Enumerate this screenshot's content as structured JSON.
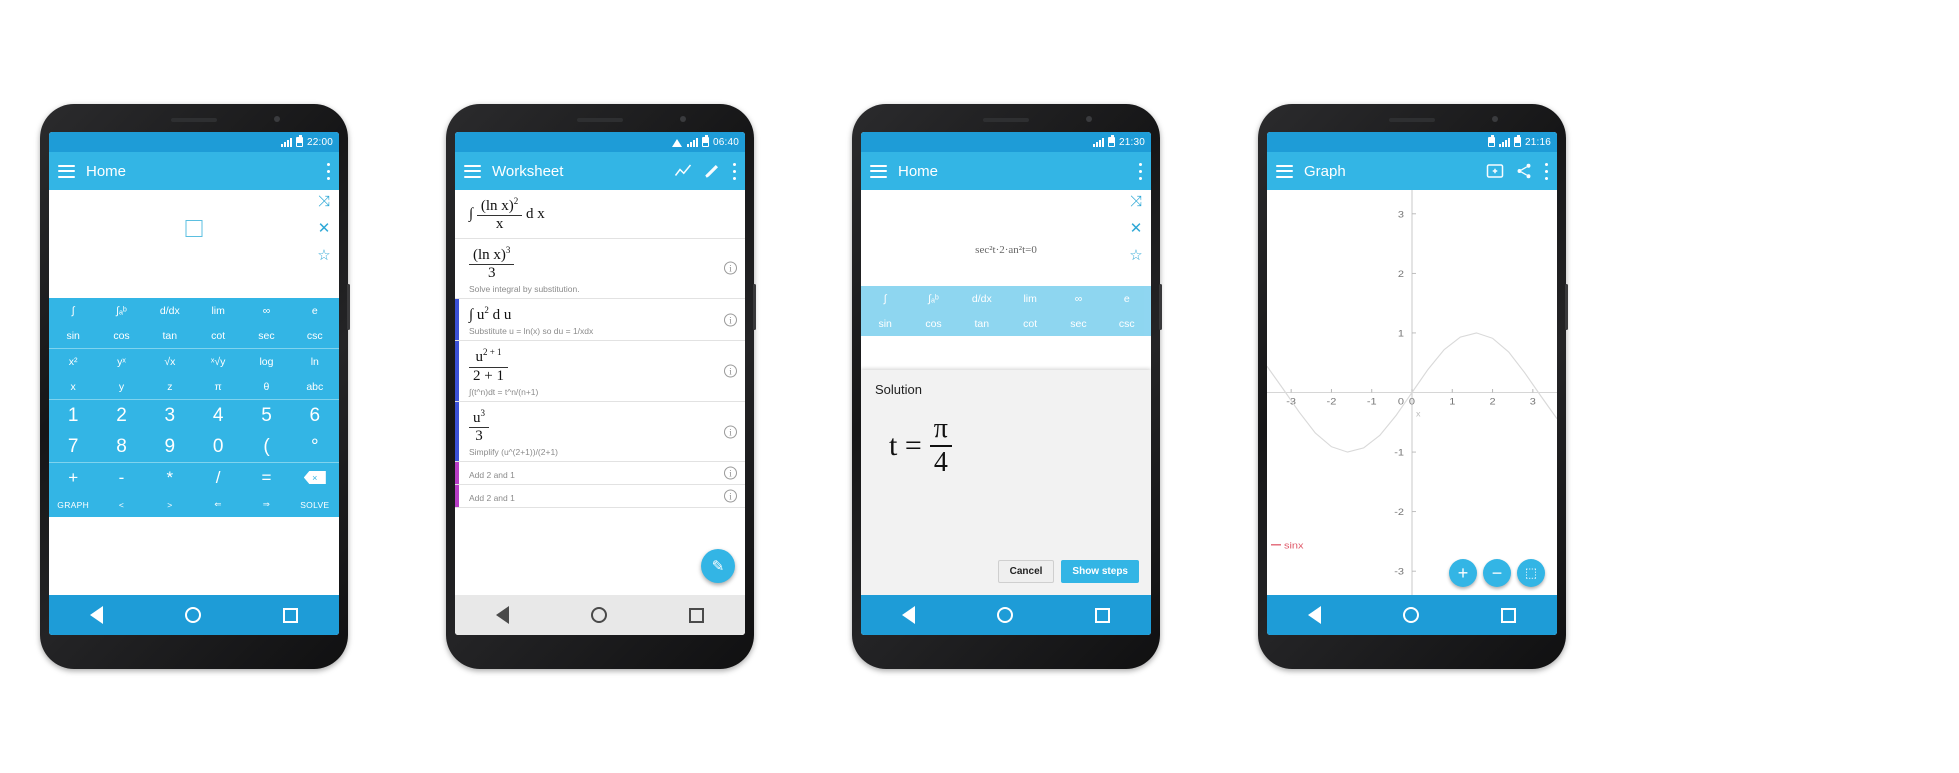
{
  "phones": [
    {
      "id": "calculator",
      "statusbar": {
        "time": "22:00",
        "icons": [
          "signal-icon",
          "battery-icon"
        ]
      },
      "appbar": {
        "title": "Home",
        "menu_icon": "hamburger-icon",
        "overflow_icon": "kebab-icon"
      },
      "input": {
        "placeholder_box": "□",
        "actions": [
          {
            "name": "shuffle-icon",
            "glyph": "⤨"
          },
          {
            "name": "close-icon",
            "glyph": "✕"
          },
          {
            "name": "star-icon",
            "glyph": "☆"
          }
        ]
      },
      "keypad_rows": [
        {
          "class": "fn",
          "keys": [
            "∫",
            "∫ₐᵇ",
            "d/dx",
            "lim",
            "∞",
            "e"
          ]
        },
        {
          "class": "fn",
          "keys": [
            "sin",
            "cos",
            "tan",
            "cot",
            "sec",
            "csc"
          ]
        },
        {
          "class": "fn sep",
          "keys": [
            "x²",
            "yˣ",
            "√x",
            "ˣ√y",
            "log",
            "ln"
          ]
        },
        {
          "class": "fn",
          "keys": [
            "x",
            "y",
            "z",
            "π",
            "θ",
            "abc"
          ]
        },
        {
          "class": "num sep",
          "keys": [
            "1",
            "2",
            "3",
            "4",
            "5",
            "6"
          ]
        },
        {
          "class": "num",
          "keys": [
            "7",
            "8",
            "9",
            "0",
            "(",
            "°"
          ]
        },
        {
          "class": "op sep",
          "keys": [
            "+",
            "-",
            "*",
            "/",
            "=",
            "⌫"
          ]
        },
        {
          "class": "small",
          "keys": [
            "GRAPH",
            "<",
            ">",
            "⇐",
            "⇒",
            "SOLVE"
          ]
        }
      ]
    },
    {
      "id": "worksheet",
      "statusbar": {
        "time": "06:40",
        "icons": [
          "wifi-icon",
          "signal-icon",
          "battery-icon"
        ]
      },
      "appbar": {
        "title": "Worksheet",
        "menu_icon": "hamburger-icon",
        "graph_icon": "chart-icon",
        "edit_icon": "pencil-icon",
        "overflow_icon": "kebab-icon"
      },
      "steps": [
        {
          "expr_html": "∫ <span class=\"frac\"><span class=\"num\">(ln x)<sup>2</sup></span><span class=\"den\">x</span></span> d x",
          "desc": "",
          "info": false,
          "mark": ""
        },
        {
          "expr_html": "<span class=\"frac\"><span class=\"num\">(ln x)<sup>3</sup></span><span class=\"den\">3</span></span>",
          "desc": "Solve integral by substitution.",
          "info": true,
          "mark": ""
        },
        {
          "expr_html": "∫ u<sup>2</sup> d u",
          "desc": "Substitute u = ln(x) so du = 1/xdx",
          "info": true,
          "mark": "marked"
        },
        {
          "expr_html": "<span class=\"frac\"><span class=\"num\">u<sup>2 + 1</sup></span><span class=\"den\">2 + 1</span></span>",
          "desc": "∫(t^n)dt = t^n/(n+1)",
          "info": true,
          "mark": "marked"
        },
        {
          "expr_html": "<span class=\"frac\"><span class=\"num\">u<sup>3</sup></span><span class=\"den\">3</span></span>",
          "desc": "Simplify (u^(2+1))/(2+1)",
          "info": true,
          "mark": "marked"
        },
        {
          "expr_html": "",
          "desc": "Add 2 and 1",
          "info": true,
          "mark": "marked2"
        },
        {
          "expr_html": "",
          "desc": "Add 2 and 1",
          "info": true,
          "mark": "marked2"
        }
      ],
      "fab": {
        "name": "edit-fab",
        "glyph": "✎"
      }
    },
    {
      "id": "solution",
      "statusbar": {
        "time": "21:30",
        "icons": [
          "signal-icon",
          "battery-icon"
        ]
      },
      "appbar": {
        "title": "Home",
        "menu_icon": "hamburger-icon",
        "overflow_icon": "kebab-icon"
      },
      "expression": "sec²t·2·an²t=0",
      "dialog": {
        "title": "Solution",
        "lhs": "t =",
        "numerator": "π",
        "denominator": "4",
        "cancel_label": "Cancel",
        "steps_label": "Show steps"
      },
      "keypad_rows": [
        {
          "class": "fn",
          "keys": [
            "∫",
            "∫ₐᵇ",
            "d/dx",
            "lim",
            "∞",
            "e"
          ]
        },
        {
          "class": "fn",
          "keys": [
            "sin",
            "cos",
            "tan",
            "cot",
            "sec",
            "csc"
          ]
        }
      ]
    },
    {
      "id": "graph",
      "statusbar": {
        "time": "21:16",
        "icons": [
          "sim-icon",
          "signal-icon",
          "battery-icon"
        ]
      },
      "appbar": {
        "title": "Graph",
        "menu_icon": "hamburger-icon",
        "add_icon": "add-to-screen-icon",
        "share_icon": "share-icon",
        "overflow_icon": "kebab-icon"
      },
      "fabs": [
        {
          "name": "zoom-in-fab",
          "glyph": "+"
        },
        {
          "name": "zoom-out-fab",
          "glyph": "−"
        },
        {
          "name": "fullscreen-fab",
          "glyph": "⬚"
        }
      ],
      "chart_data": {
        "type": "line",
        "title": "",
        "xlabel": "x",
        "ylabel": "",
        "series": [
          {
            "name": "sinx",
            "color": "#e05a6a",
            "expression": "sin x"
          }
        ],
        "legend_entries": [
          "sinx"
        ],
        "legend_position": "bottom-left",
        "xlim": [
          -3.6,
          3.6
        ],
        "ylim": [
          -3.4,
          3.4
        ],
        "xticks": [
          -3,
          -2,
          -1,
          0,
          1,
          2,
          3
        ],
        "yticks": [
          -3,
          -2,
          -1,
          0,
          1,
          2,
          3
        ],
        "grid": false,
        "x": [
          -3.6,
          -3.2,
          -2.8,
          -2.4,
          -2.0,
          -1.6,
          -1.2,
          -0.8,
          -0.4,
          0,
          0.4,
          0.8,
          1.2,
          1.6,
          2.0,
          2.4,
          2.8,
          3.2,
          3.6
        ],
        "y": [
          0.44,
          0.06,
          -0.33,
          -0.68,
          -0.91,
          -1.0,
          -0.93,
          -0.72,
          -0.39,
          0,
          0.39,
          0.72,
          0.93,
          1.0,
          0.91,
          0.68,
          0.33,
          -0.06,
          -0.44
        ]
      }
    }
  ],
  "colors": {
    "accent": "#33b5e5",
    "status": "#1e9cd7",
    "plot": "#e05a6a",
    "mark_blue": "#3b51d6",
    "mark_purple": "#b63dc4"
  }
}
